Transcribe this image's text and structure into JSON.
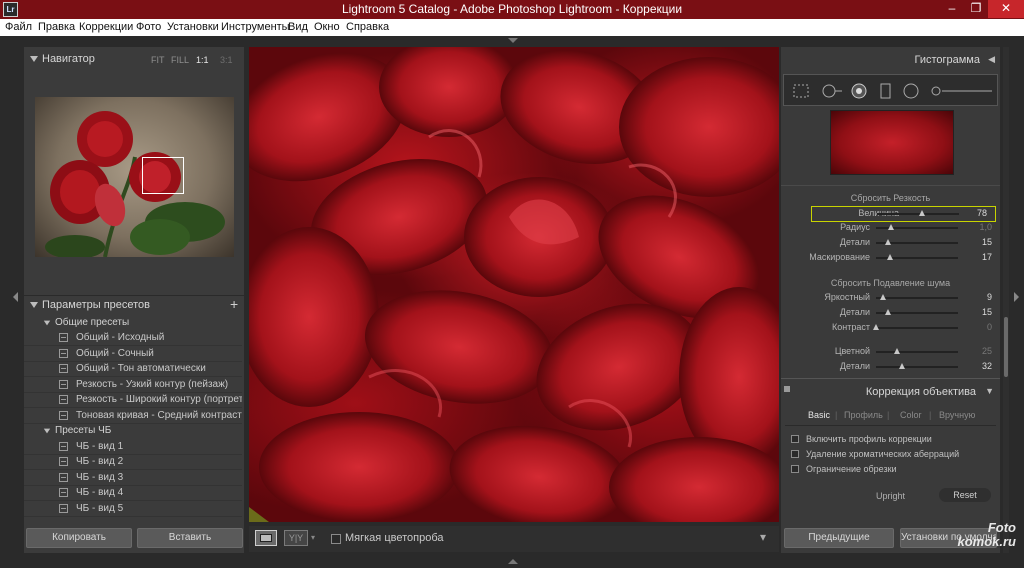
{
  "window": {
    "title": "Lightroom 5 Catalog - Adobe Photoshop Lightroom - Коррекции",
    "icon_text": "Lr",
    "min_symbol": "–",
    "max_symbol": "❐",
    "close_symbol": "✕"
  },
  "menu": [
    "Файл",
    "Правка",
    "Коррекции",
    "Фото",
    "Установки",
    "Инструменты",
    "Вид",
    "Окно",
    "Справка"
  ],
  "navigator": {
    "title": "Навигатор",
    "zoom_fit": "FIT",
    "zoom_fill": "FILL",
    "zoom_1_1": "1:1",
    "zoom_3_1": "3:1"
  },
  "presets": {
    "title": "Параметры пресетов",
    "add_symbol": "+",
    "folders": [
      {
        "name": "Общие пресеты",
        "items": [
          "Общий - Исходный",
          "Общий - Сочный",
          "Общий - Тон автоматически",
          "Резкость - Узкий контур (пейзаж)",
          "Резкость - Широкий контур (портрет)",
          "Тоновая кривая - Средний контраст"
        ]
      },
      {
        "name": "Пресеты ЧБ",
        "items": [
          "ЧБ - вид 1",
          "ЧБ - вид 2",
          "ЧБ - вид 3",
          "ЧБ - вид 4",
          "ЧБ - вид 5"
        ]
      }
    ]
  },
  "left_buttons": {
    "copy": "Копировать",
    "paste": "Вставить"
  },
  "toolbar": {
    "yy_label": "Y|Y",
    "softproof_label": "Мягкая цветопроба",
    "dropdown_symbol": "▾"
  },
  "histogram": {
    "title": "Гистограмма",
    "collapse_symbol": "◀"
  },
  "detail": {
    "sharpening_title": "Сбросить Резкость",
    "sharpening": [
      {
        "label": "Величина",
        "value": "78",
        "pos": 0.55,
        "highlight": true,
        "dim": false
      },
      {
        "label": "Радиус",
        "value": "1,0",
        "pos": 0.18,
        "highlight": false,
        "dim": true
      },
      {
        "label": "Детали",
        "value": "15",
        "pos": 0.15,
        "highlight": false,
        "dim": false
      },
      {
        "label": "Маскирование",
        "value": "17",
        "pos": 0.17,
        "highlight": false,
        "dim": false
      }
    ],
    "noise_title": "Сбросить Подавление шума",
    "noise": [
      {
        "label": "Яркостный",
        "value": "9",
        "pos": 0.09,
        "highlight": false,
        "dim": false
      },
      {
        "label": "Детали",
        "value": "15",
        "pos": 0.15,
        "highlight": false,
        "dim": false
      },
      {
        "label": "Контраст",
        "value": "0",
        "pos": 0.0,
        "highlight": false,
        "dim": true
      }
    ],
    "color": [
      {
        "label": "Цветной",
        "value": "25",
        "pos": 0.25,
        "highlight": false,
        "dim": true
      },
      {
        "label": "Детали",
        "value": "32",
        "pos": 0.32,
        "highlight": false,
        "dim": false
      }
    ]
  },
  "lens": {
    "title": "Коррекция объектива",
    "collapse_symbol": "▼",
    "tabs": [
      "Basic",
      "Профиль",
      "Color",
      "Вручную"
    ],
    "separator": "|",
    "options": [
      "Включить профиль коррекции",
      "Удаление хроматических аберраций",
      "Ограничение обрезки"
    ],
    "upright_label": "Upright",
    "reset_label": "Reset"
  },
  "right_buttons": {
    "previous": "Предыдущие",
    "defaults": "Установки по умолчанию"
  },
  "watermark": {
    "line1": "Foto",
    "line2": "komok.ru"
  },
  "colors": {
    "title_bar": "#7a0f14",
    "highlight_box": "#c8d400",
    "panel": "#3b3b3b",
    "workspace": "#2a2a2a"
  }
}
